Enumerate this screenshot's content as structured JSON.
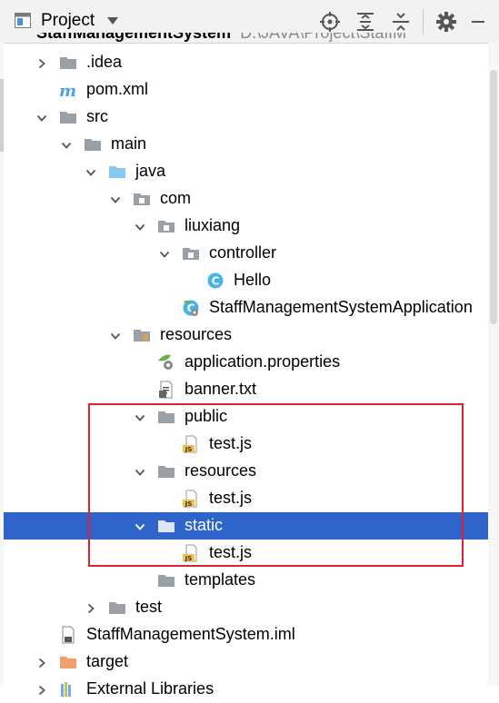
{
  "toolbar": {
    "title": "Project",
    "buttons": [
      "locate-icon",
      "expand-all-icon",
      "collapse-all-icon",
      "settings-icon"
    ]
  },
  "partial_row": {
    "label": "StaffManagementSystem",
    "path": "D:\\JAVA\\Project\\StaffM"
  },
  "tree": [
    {
      "label": ".idea",
      "icon": "folder-gray",
      "arrow": "collapsed"
    },
    {
      "label": "pom.xml",
      "icon": "maven-m",
      "arrow": "none"
    },
    {
      "label": "src",
      "icon": "folder-gray",
      "arrow": "expanded"
    },
    {
      "label": "main",
      "icon": "folder-gray",
      "arrow": "expanded"
    },
    {
      "label": "java",
      "icon": "folder-blue",
      "arrow": "expanded"
    },
    {
      "label": "com",
      "icon": "package",
      "arrow": "expanded"
    },
    {
      "label": "liuxiang",
      "icon": "package",
      "arrow": "expanded"
    },
    {
      "label": "controller",
      "icon": "package",
      "arrow": "expanded"
    },
    {
      "label": "Hello",
      "icon": "java-class",
      "arrow": "none"
    },
    {
      "label": "StaffManagementSystemApplication",
      "icon": "spring-class",
      "arrow": "none"
    },
    {
      "label": "resources",
      "icon": "resources-folder",
      "arrow": "expanded"
    },
    {
      "label": "application.properties",
      "icon": "spring-properties",
      "arrow": "none"
    },
    {
      "label": "banner.txt",
      "icon": "text-file",
      "arrow": "none"
    },
    {
      "label": "public",
      "icon": "folder-gray",
      "arrow": "expanded"
    },
    {
      "label": "test.js",
      "icon": "js-file",
      "arrow": "none"
    },
    {
      "label": "resources",
      "icon": "folder-gray",
      "arrow": "expanded"
    },
    {
      "label": "test.js",
      "icon": "js-file",
      "arrow": "none"
    },
    {
      "label": "static",
      "icon": "folder-gray",
      "arrow": "expanded",
      "selected": true
    },
    {
      "label": "test.js",
      "icon": "js-file",
      "arrow": "none"
    },
    {
      "label": "templates",
      "icon": "folder-gray",
      "arrow": "none"
    },
    {
      "label": "test",
      "icon": "folder-gray",
      "arrow": "collapsed"
    },
    {
      "label": "StaffManagementSystem.iml",
      "icon": "iml-file",
      "arrow": "none"
    },
    {
      "label": "target",
      "icon": "folder-orange",
      "arrow": "collapsed"
    },
    {
      "label": "External Libraries",
      "icon": "libraries",
      "arrow": "collapsed"
    }
  ],
  "colors": {
    "selection": "#2f65ca",
    "highlight_box": "#e0212e",
    "folder_gray": "#9aa0a6",
    "folder_blue": "#87c9f0",
    "folder_orange": "#f0a06a"
  }
}
